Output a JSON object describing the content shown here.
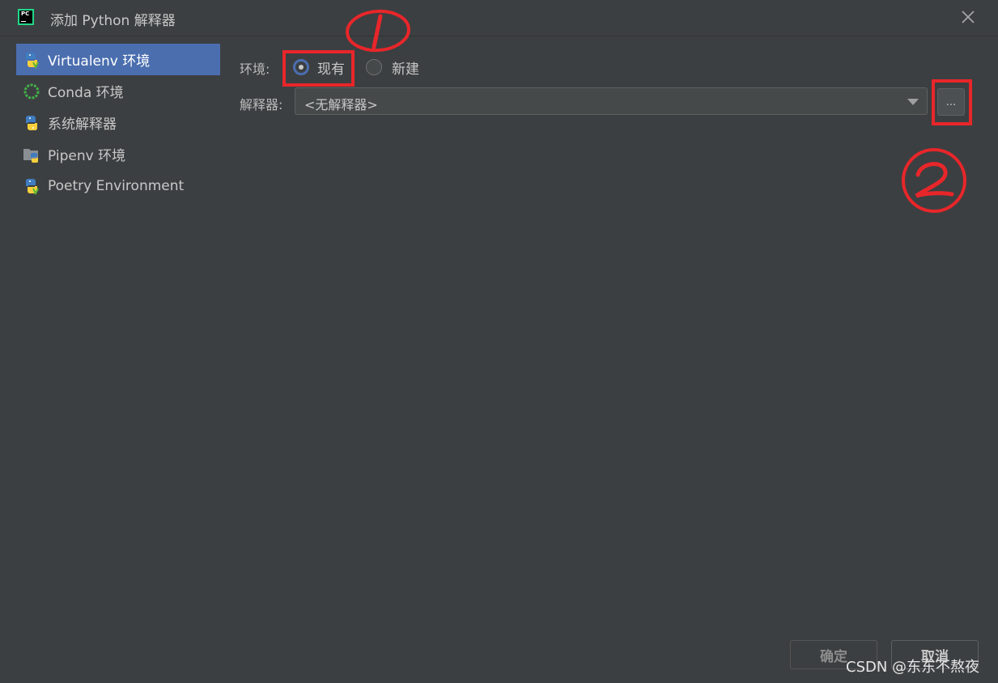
{
  "window": {
    "title": "添加 Python 解释器",
    "app_icon": "pycharm-icon",
    "close_icon": "close-icon"
  },
  "sidebar": {
    "items": [
      {
        "label": "Virtualenv 环境",
        "icon": "python-virtualenv-icon",
        "selected": true
      },
      {
        "label": "Conda 环境",
        "icon": "conda-icon",
        "selected": false
      },
      {
        "label": "系统解释器",
        "icon": "python-icon",
        "selected": false
      },
      {
        "label": "Pipenv 环境",
        "icon": "pipenv-folder-icon",
        "selected": false
      },
      {
        "label": "Poetry Environment",
        "icon": "poetry-icon",
        "selected": false
      }
    ]
  },
  "form": {
    "env_label": "环境:",
    "env_options": [
      {
        "label": "现有",
        "checked": true
      },
      {
        "label": "新建",
        "checked": false
      }
    ],
    "interpreter_label": "解释器:",
    "interpreter_value": "<无解释器>",
    "browse_label": "..."
  },
  "footer": {
    "ok_label": "确定",
    "cancel_label": "取消"
  },
  "annotations": {
    "marker_1": "①",
    "marker_2": "②",
    "color": "#e8262a"
  },
  "watermark": "CSDN @东东不熬夜",
  "colors": {
    "selection": "#4b6eaf",
    "background": "#3c3f41"
  }
}
